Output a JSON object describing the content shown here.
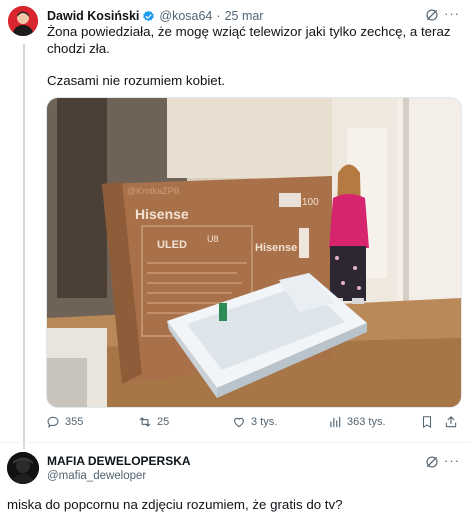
{
  "tweet": {
    "author_name": "Dawid Kosiński",
    "author_handle": "@kosa64",
    "separator": "·",
    "date": "25 mar",
    "text_line1": "Żona powiedziała, że mogę wziąć telewizor jaki tylko zechcę, a teraz chodzi zła.",
    "text_line2": "Czasami nie rozumiem kobiet.",
    "icons": {
      "verified": "verified-badge-icon",
      "grok": "grok-icon",
      "more": "more-icon"
    },
    "media": {
      "alt": "woman-standing-next-to-tv-box-and-bathtub",
      "box_watermark": "@KrotkaZPB",
      "brand": "Hisense",
      "panel_text": "ULED",
      "panel_code": "U8",
      "size_badge": "100"
    },
    "actions": {
      "replies": "355",
      "reposts": "25",
      "likes": "3 tys.",
      "views": "363 tys."
    },
    "accent_color": "#1d9bf0"
  },
  "reply": {
    "author_name": "MAFIA DEWELOPERSKA",
    "author_handle": "@mafia_deweloper",
    "text": "miska do popcornu na zdjęciu rozumiem, że gratis do tv?"
  }
}
